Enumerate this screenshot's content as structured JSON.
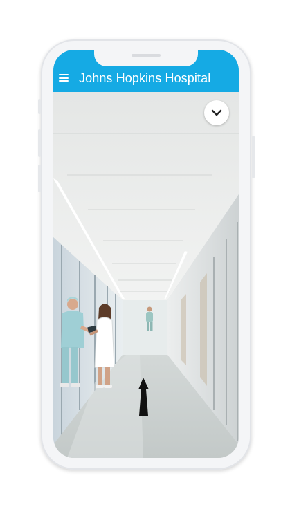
{
  "app": {
    "title": "Johns Hopkins Hospital"
  },
  "icons": {
    "menu": "hamburger-menu-icon",
    "expand": "chevron-down-icon",
    "navigation": "forward-arrow-icon"
  },
  "colors": {
    "appbar": "#15aae4",
    "appbar_text": "#ffffff",
    "arrow": "#111111"
  }
}
